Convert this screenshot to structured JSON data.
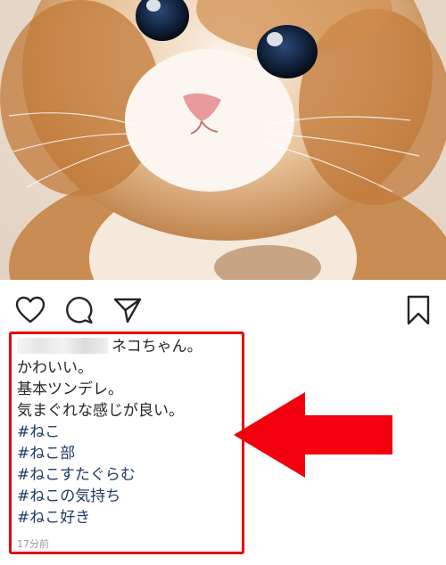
{
  "post": {
    "image": "kitten-photo",
    "actions": [
      {
        "name": "like-button",
        "icon": "heart-icon"
      },
      {
        "name": "comment-button",
        "icon": "speech-bubble-icon"
      },
      {
        "name": "share-button",
        "icon": "paper-plane-icon"
      },
      {
        "name": "save-button",
        "icon": "bookmark-icon"
      }
    ],
    "caption": {
      "username_redacted": true,
      "first_line": "ネコちゃん。",
      "lines": [
        "かわいい。",
        "基本ツンデレ。",
        "気まぐれな感じが良い。"
      ],
      "hashtags": [
        "#ねこ",
        "#ねこ部",
        "#ねこすたぐらむ",
        "#ねこの気持ち",
        "#ねこ好き"
      ]
    },
    "timestamp": "17分前"
  },
  "annotation": {
    "highlight_color": "#e8000d",
    "arrow_color": "#f2000d"
  }
}
